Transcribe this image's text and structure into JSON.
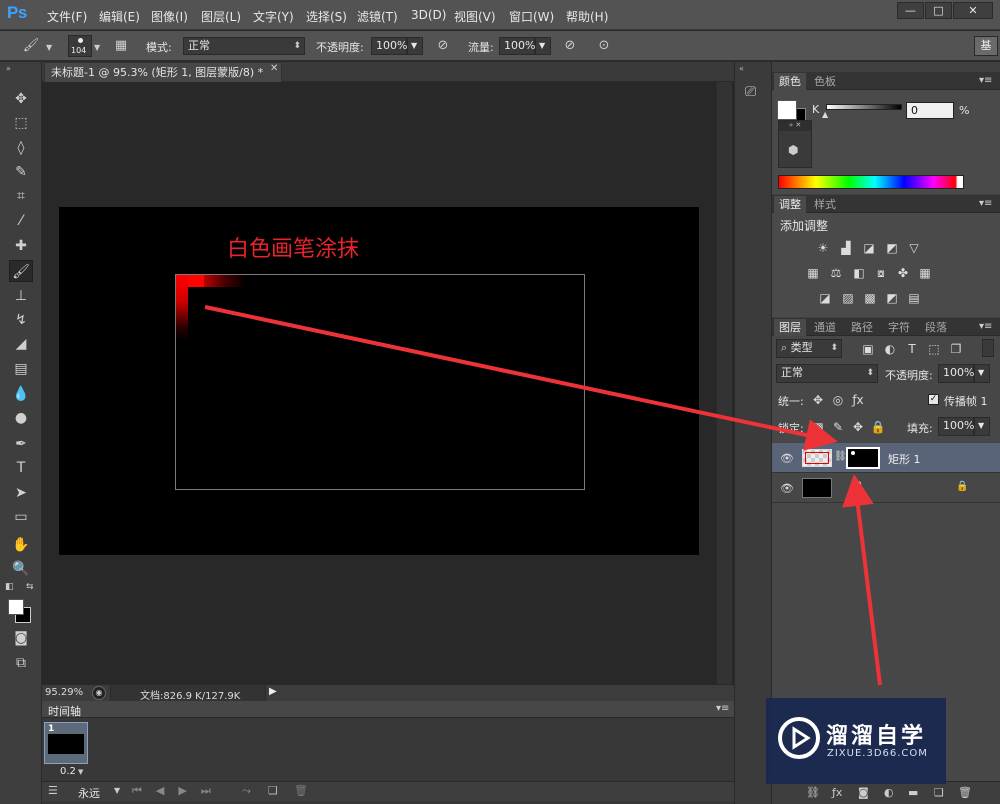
{
  "app": {
    "logo": "Ps",
    "menus": [
      "文件(F)",
      "编辑(E)",
      "图像(I)",
      "图层(L)",
      "文字(Y)",
      "选择(S)",
      "滤镜(T)",
      "3D(D)",
      "视图(V)",
      "窗口(W)",
      "帮助(H)"
    ],
    "window_buttons": {
      "minimize": "—",
      "maximize": "□",
      "close": "✕"
    }
  },
  "options": {
    "brush_size": "104",
    "mode_label": "模式:",
    "mode_value": "正常",
    "opacity_label": "不透明度:",
    "opacity_value": "100%",
    "flow_label": "流量:",
    "flow_value": "100%",
    "workspace": "基"
  },
  "document": {
    "tab_title": "未标题-1 @ 95.3% (矩形 1, 图层蒙版/8) *",
    "annotation": "白色画笔涂抹",
    "zoom": "95.29%",
    "doc_info": "文档:826.9 K/127.9K"
  },
  "timeline": {
    "title": "时间轴",
    "frame_number": "1",
    "frame_delay": "0.2",
    "loop": "永远"
  },
  "color_panel": {
    "tabs": [
      "颜色",
      "色板"
    ],
    "channel": "K",
    "value": "0",
    "unit": "%"
  },
  "adjust_panel": {
    "tabs": [
      "调整",
      "样式"
    ],
    "title": "添加调整"
  },
  "layers_panel": {
    "tabs": [
      "图层",
      "通道",
      "路径",
      "字符",
      "段落"
    ],
    "filter_label": "类型",
    "blend_mode": "正常",
    "opacity_label": "不透明度:",
    "opacity_value": "100%",
    "unify_label": "统一:",
    "propagate_label": "传播帧 1",
    "lock_label": "锁定:",
    "fill_label": "填充:",
    "fill_value": "100%",
    "layers": [
      {
        "name": "矩形 1",
        "selected": true
      },
      {
        "name": "",
        "selected": false
      }
    ]
  },
  "watermark": {
    "title": "溜溜自学",
    "subtitle": "ZIXUE.3D66.COM"
  },
  "colors": {
    "accent_blue": "#3aa3ff",
    "annotation_red": "#e8232b",
    "arrow_red": "#ee3338",
    "selected_layer": "#5a6478"
  }
}
